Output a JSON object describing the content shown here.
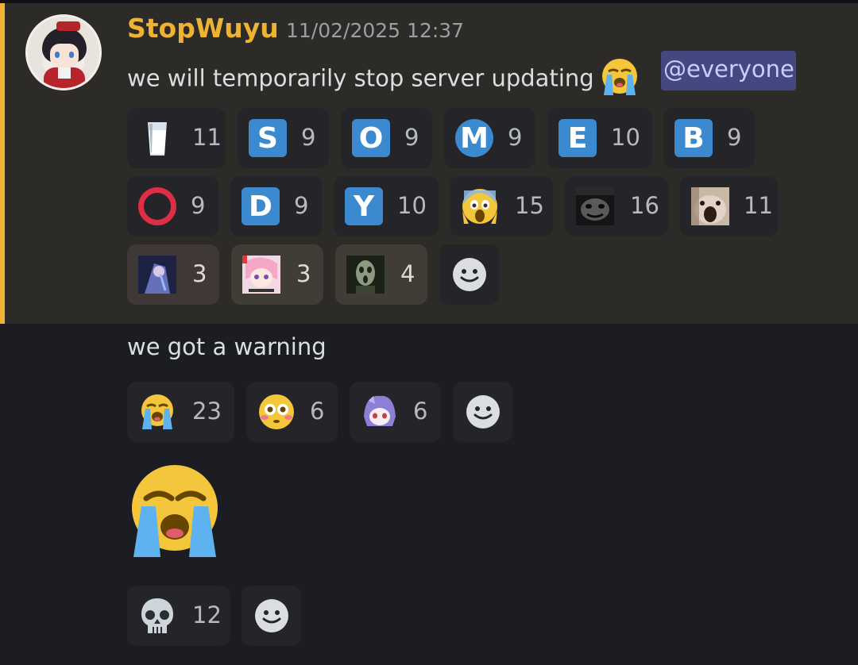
{
  "message": {
    "username": "StopWuyu",
    "timestamp": "11/02/2025 12:37",
    "text": "we will temporarily stop server updating",
    "mention": "@everyone",
    "reactions_row1": [
      {
        "icon": "milk-glass-icon",
        "count": "11"
      },
      {
        "icon": "letter-s-icon",
        "letter": "S",
        "count": "9"
      },
      {
        "icon": "letter-o-icon",
        "letter": "O",
        "count": "9"
      },
      {
        "icon": "metro-m-icon",
        "letter": "M",
        "count": "9"
      },
      {
        "icon": "letter-e-icon",
        "letter": "E",
        "count": "10"
      },
      {
        "icon": "letter-b-icon",
        "letter": "B",
        "count": "9"
      }
    ],
    "reactions_row2": [
      {
        "icon": "red-circle-icon",
        "count": "9"
      },
      {
        "icon": "letter-d-icon",
        "letter": "D",
        "count": "9"
      },
      {
        "icon": "letter-y-icon",
        "letter": "Y",
        "count": "10"
      },
      {
        "icon": "screaming-face-icon",
        "count": "15"
      },
      {
        "icon": "dark-face-emote-icon",
        "count": "16"
      },
      {
        "icon": "hamster-emote-icon",
        "count": "11"
      }
    ],
    "reactions_row3": [
      {
        "icon": "anime-girl-emote-icon",
        "count": "3"
      },
      {
        "icon": "anime-girl-pink-emote-icon",
        "count": "3"
      },
      {
        "icon": "ghost-face-emote-icon",
        "count": "4"
      }
    ]
  },
  "message2": {
    "text": "we got a warning",
    "reactions": [
      {
        "icon": "loudly-crying-face-icon",
        "count": "23"
      },
      {
        "icon": "flushed-face-icon",
        "count": "6"
      },
      {
        "icon": "anime-girl-purple-emote-icon",
        "count": "6"
      }
    ]
  },
  "message3": {
    "big_emoji": "loudly-crying-face-icon",
    "reactions": [
      {
        "icon": "skull-icon",
        "count": "12"
      }
    ]
  },
  "colors": {
    "accent": "#f0b232",
    "mention_bg": "#454880",
    "letter_blue": "#3b8ad0"
  }
}
